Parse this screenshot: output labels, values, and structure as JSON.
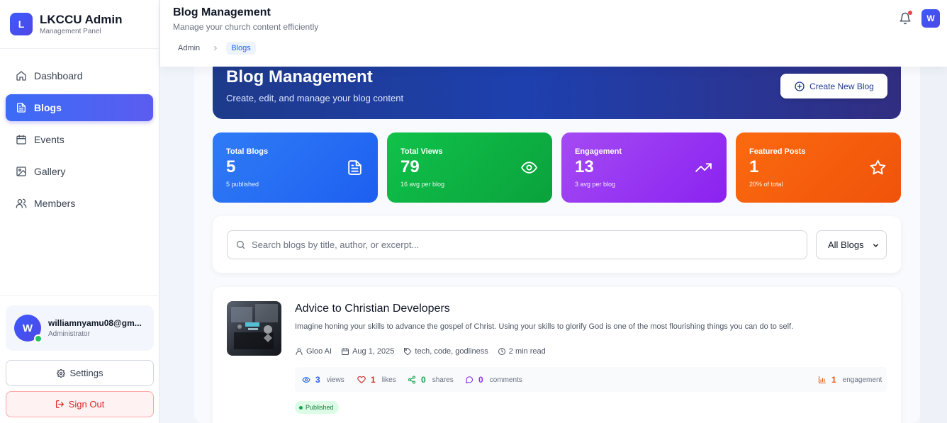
{
  "brand": {
    "logo_letter": "L",
    "title": "LKCCU Admin",
    "subtitle": "Management Panel"
  },
  "sidebar": {
    "items": [
      {
        "label": "Dashboard",
        "icon": "home-icon"
      },
      {
        "label": "Blogs",
        "icon": "document-icon",
        "active": true
      },
      {
        "label": "Events",
        "icon": "calendar-icon"
      },
      {
        "label": "Gallery",
        "icon": "image-icon"
      },
      {
        "label": "Members",
        "icon": "users-icon"
      }
    ],
    "user": {
      "avatar_letter": "W",
      "email": "williamnyamu08@gm...",
      "role": "Administrator"
    },
    "settings_label": "Settings",
    "signout_label": "Sign Out"
  },
  "header": {
    "title": "Blog Management",
    "subtitle": "Manage your church content efficiently",
    "breadcrumb": [
      "Admin",
      "Blogs"
    ],
    "avatar_letter": "W"
  },
  "hero": {
    "title": "Blog Management",
    "subtitle": "Create, edit, and manage your blog content",
    "button_label": "Create New Blog"
  },
  "stats": [
    {
      "label": "Total Blogs",
      "value": "5",
      "sub": "5 published",
      "icon": "document-icon"
    },
    {
      "label": "Total Views",
      "value": "79",
      "sub": "16 avg per blog",
      "icon": "eye-icon"
    },
    {
      "label": "Engagement",
      "value": "13",
      "sub": "3 avg per blog",
      "icon": "trending-up-icon"
    },
    {
      "label": "Featured Posts",
      "value": "1",
      "sub": "20% of total",
      "icon": "star-icon"
    }
  ],
  "search": {
    "placeholder": "Search blogs by title, author, or excerpt...",
    "filter_value": "All Blogs"
  },
  "blog": {
    "title": "Advice to Christian Developers",
    "excerpt": "Imagine honing your skills to advance the gospel of Christ. Using your skills to glorify God is one of the most flourishing things you can do to self.",
    "author": "Gloo AI",
    "date": "Aug 1, 2025",
    "tags": "tech, code, godliness",
    "read_time": "2 min read",
    "views": {
      "value": "3",
      "label": "views"
    },
    "likes": {
      "value": "1",
      "label": "likes"
    },
    "shares": {
      "value": "0",
      "label": "shares"
    },
    "comments": {
      "value": "0",
      "label": "comments"
    },
    "engagement": {
      "value": "1",
      "label": "engagement"
    },
    "status": "Published"
  },
  "colors": {
    "accent": "#3b5bfd",
    "hero": "#1e3a8a",
    "views": "#2563eb",
    "likes": "#dc2626",
    "shares": "#16a34a",
    "comments": "#9333ea",
    "engagement": "#ea580c"
  }
}
